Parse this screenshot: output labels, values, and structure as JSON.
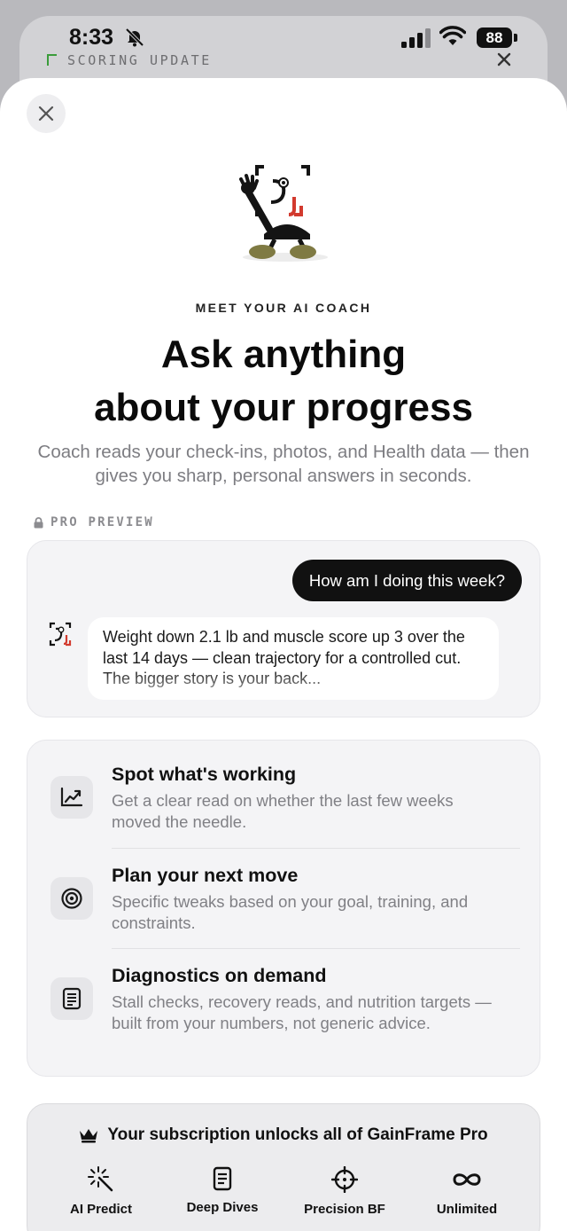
{
  "status_bar": {
    "time": "8:33",
    "battery": "88",
    "background_label": "SCORING UPDATE"
  },
  "sheet": {
    "eyebrow": "MEET YOUR AI COACH",
    "headline_line1": "Ask anything",
    "headline_line2": "about your progress",
    "subhead": "Coach reads your check-ins, photos, and Health data — then gives you sharp, personal answers in seconds.",
    "pro_preview_label": "PRO PREVIEW",
    "chat": {
      "user_message": "How am I doing this week?",
      "coach_reply": "Weight down 2.1 lb and muscle score up 3 over the last 14 days — clean trajectory for a controlled cut. The bigger story is your back..."
    },
    "features": [
      {
        "icon": "trend-chart-icon",
        "title": "Spot what's working",
        "description": "Get a clear read on whether the last few weeks moved the needle."
      },
      {
        "icon": "target-icon",
        "title": "Plan your next move",
        "description": "Specific tweaks based on your goal, training, and constraints."
      },
      {
        "icon": "document-icon",
        "title": "Diagnostics on demand",
        "description": "Stall checks, recovery reads, and nutrition targets — built from your numbers, not generic advice."
      }
    ],
    "subscription": {
      "title": "Your subscription unlocks all of GainFrame Pro",
      "benefits": [
        {
          "icon": "sparkle-wand-icon",
          "label": "AI Predict"
        },
        {
          "icon": "document-icon",
          "label": "Deep Dives"
        },
        {
          "icon": "crosshair-icon",
          "label": "Precision BF"
        },
        {
          "icon": "infinity-icon",
          "label": "Unlimited"
        }
      ]
    }
  },
  "colors": {
    "accent_green": "#3a9c3a",
    "brand_red": "#d23a2e",
    "dark": "#111111",
    "muted_text": "#7d7d82"
  }
}
